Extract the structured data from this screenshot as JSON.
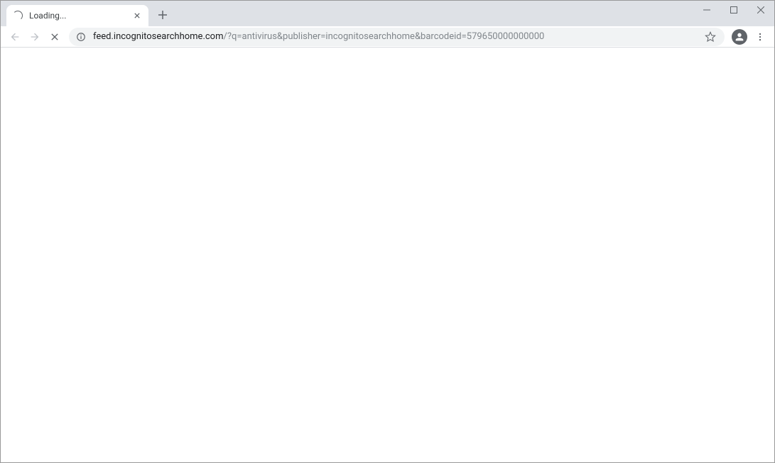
{
  "tab": {
    "title": "Loading..."
  },
  "url": {
    "domain": "feed.incognitosearchhome.com",
    "path": "/?q=antivirus&publisher=incognitosearchhome&barcodeid=579650000000000"
  }
}
